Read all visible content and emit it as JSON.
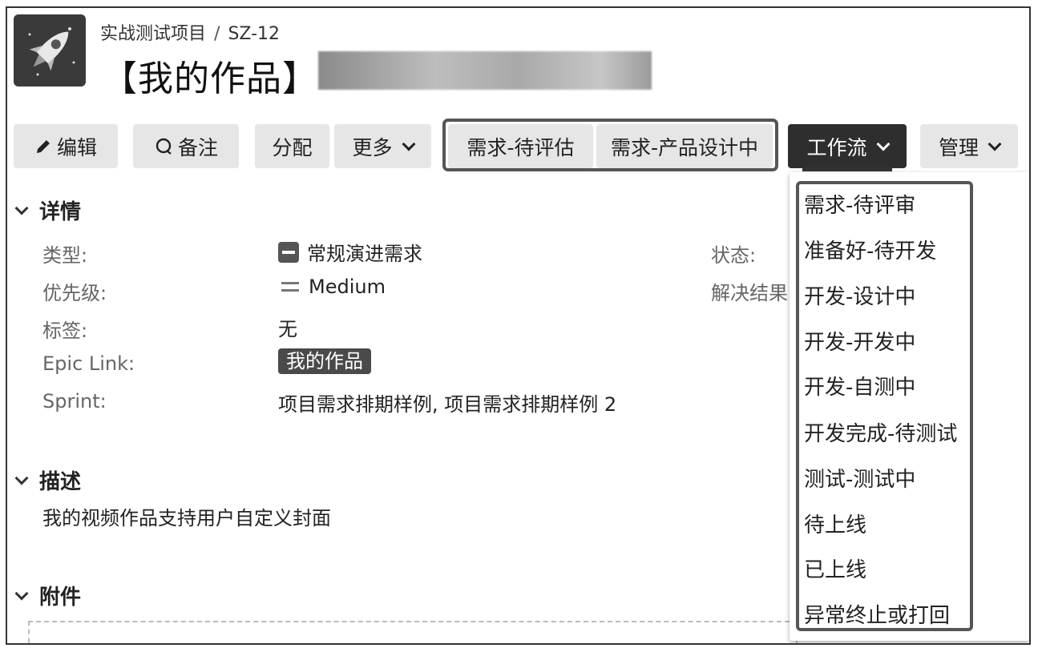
{
  "header": {
    "project": "实战测试项目",
    "separator": "/",
    "issue_key": "SZ-12",
    "title": "【我的作品】"
  },
  "toolbar": {
    "edit": "编辑",
    "comment": "备注",
    "assign": "分配",
    "more": "更多",
    "transition_1": "需求-待评估",
    "transition_2": "需求-产品设计中",
    "workflow": "工作流",
    "admin": "管理"
  },
  "details": {
    "heading": "详情",
    "type_label": "类型:",
    "type_value": "常规演进需求",
    "priority_label": "优先级:",
    "priority_value": "Medium",
    "labels_label": "标签:",
    "labels_value": "无",
    "epic_label": "Epic Link:",
    "epic_value": "我的作品",
    "sprint_label": "Sprint:",
    "sprint_value": "项目需求排期样例, 项目需求排期样例 2",
    "status_label": "状态:",
    "resolution_label": "解决结果"
  },
  "description": {
    "heading": "描述",
    "text": "我的视频作品支持用户自定义封面"
  },
  "attachments": {
    "heading": "附件"
  },
  "workflow_menu": {
    "items": [
      "需求-待评审",
      "准备好-待开发",
      "开发-设计中",
      "开发-开发中",
      "开发-自测中",
      "开发完成-待测试",
      "测试-测试中",
      "待上线",
      "已上线",
      "异常终止或打回"
    ]
  },
  "colors": {
    "button_bg": "#e6e6e6",
    "workflow_button_bg": "#2e2e2e",
    "highlight_border": "#555555"
  }
}
